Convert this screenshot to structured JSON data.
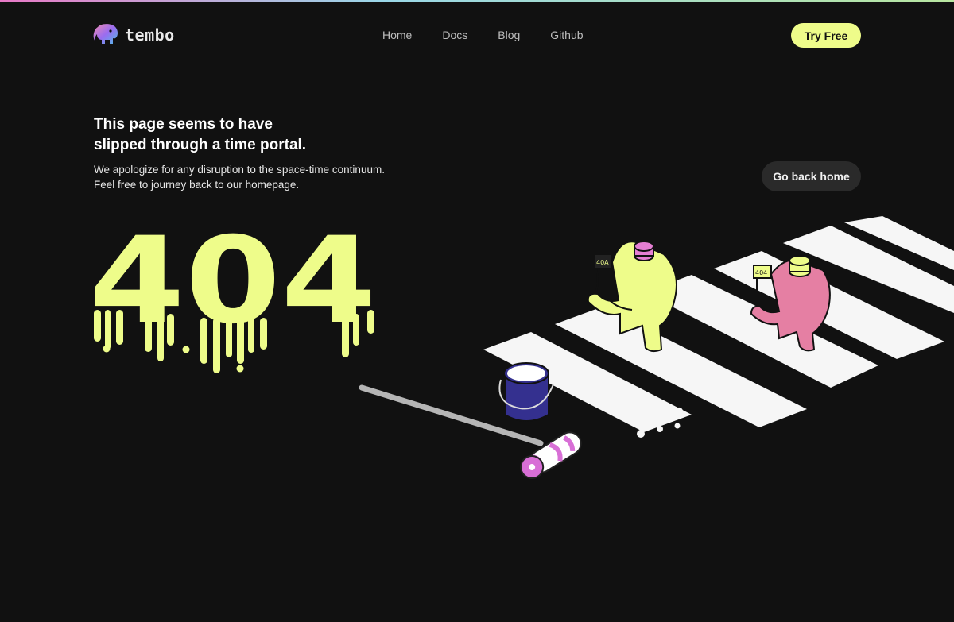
{
  "brand": {
    "name": "tembo"
  },
  "nav": {
    "items": [
      {
        "label": "Home"
      },
      {
        "label": "Docs"
      },
      {
        "label": "Blog"
      },
      {
        "label": "Github"
      }
    ]
  },
  "header": {
    "cta_label": "Try Free"
  },
  "hero": {
    "headline_line1": "This page seems to have",
    "headline_line2": "slipped through a time portal.",
    "sub_line1": "We apologize for any disruption to the space-time continuum.",
    "sub_line2": "Feel free to journey back to our homepage.",
    "home_button_label": "Go back home",
    "error_code": "404"
  },
  "illustration": {
    "flag_left_label": "40A",
    "flag_right_label": "404",
    "icons": [
      "elephant-logo-icon",
      "paint-bucket-icon",
      "paint-roller-icon",
      "elephant-yellow-icon",
      "elephant-pink-icon"
    ]
  },
  "colors": {
    "background": "#111111",
    "accent": "#eefc8a",
    "pink": "#e57fa3",
    "bucket": "#34308f",
    "roller": "#d86fd6"
  }
}
